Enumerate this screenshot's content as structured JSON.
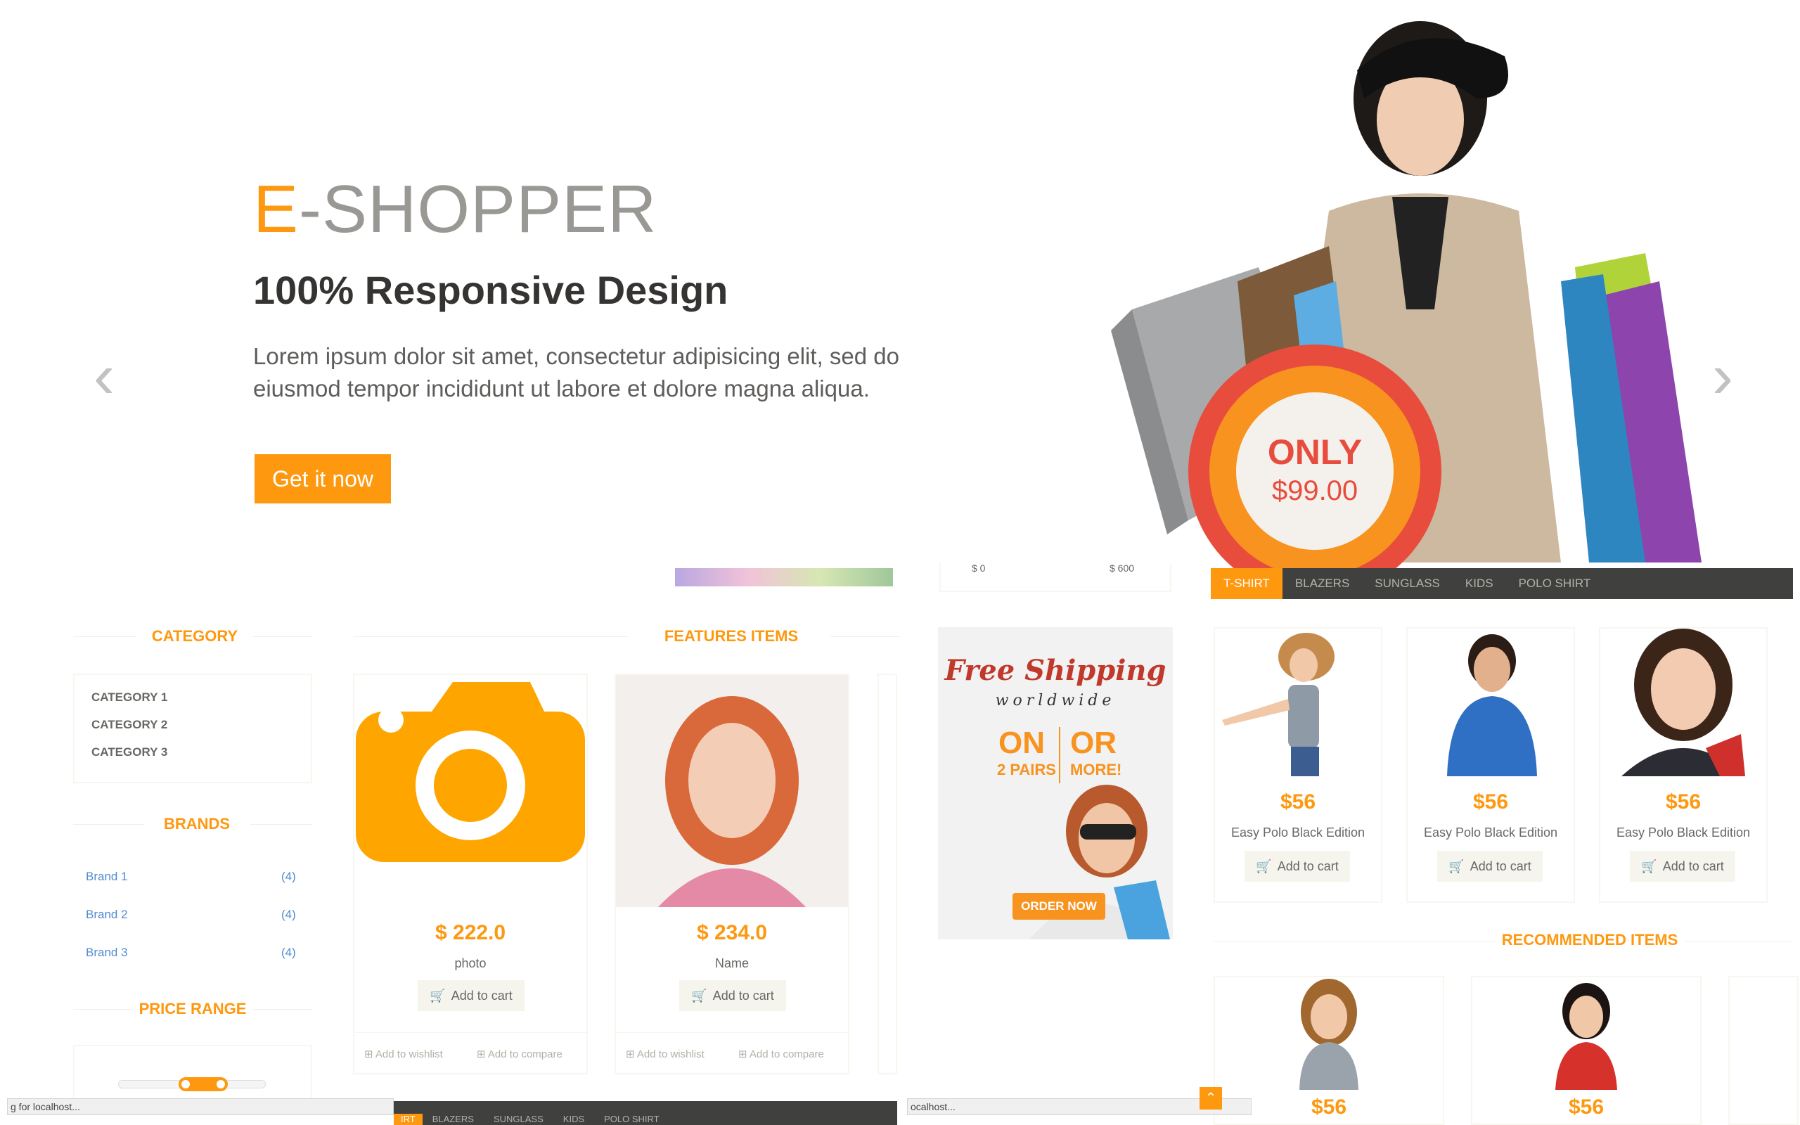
{
  "hero": {
    "brand_accent": "E",
    "brand_rest": "-SHOPPER",
    "subtitle": "100% Responsive Design",
    "text": "Lorem ipsum dolor sit amet, consectetur adipisicing elit, sed do eiusmod tempor incididunt ut labore et dolore magna aliqua.",
    "button": "Get it now",
    "badge_only": "ONLY",
    "badge_price": "$99.00",
    "prev_icon": "‹",
    "next_icon": "›"
  },
  "sidebar": {
    "category_title": "CATEGORY",
    "categories": [
      "CATEGORY 1",
      "CATEGORY 2",
      "CATEGORY 3"
    ],
    "brands_title": "BRANDS",
    "brands": [
      {
        "name": "Brand 1",
        "count": "(4)"
      },
      {
        "name": "Brand 2",
        "count": "(4)"
      },
      {
        "name": "Brand 3",
        "count": "(4)"
      }
    ],
    "price_range_title": "PRICE RANGE"
  },
  "features": {
    "title": "FEATURES ITEMS",
    "items": [
      {
        "price": "$ 222.0",
        "name": "photo",
        "cart": "Add to cart",
        "wishlist": "Add to wishlist",
        "compare": "Add to compare"
      },
      {
        "price": "$ 234.0",
        "name": "Name",
        "cart": "Add to cart",
        "wishlist": "Add to wishlist",
        "compare": "Add to compare"
      }
    ]
  },
  "price_slider": {
    "min_label": "$ 0",
    "max_label": "$ 600"
  },
  "ad": {
    "free": "Free Shipping",
    "world": "worldwide",
    "on": "ON",
    "or": "OR",
    "pairs": "2 PAIRS",
    "more": "MORE!",
    "order": "ORDER NOW"
  },
  "tabs": [
    "T-SHIRT",
    "BLAZERS",
    "SUNGLASS",
    "KIDS",
    "POLO SHIRT"
  ],
  "tab_products": [
    {
      "price": "$56",
      "name": "Easy Polo Black Edition",
      "cart": "Add to cart"
    },
    {
      "price": "$56",
      "name": "Easy Polo Black Edition",
      "cart": "Add to cart"
    },
    {
      "price": "$56",
      "name": "Easy Polo Black Edition",
      "cart": "Add to cart"
    }
  ],
  "recommended": {
    "title": "RECOMMENDED ITEMS",
    "prices": [
      "$56",
      "$56"
    ]
  },
  "status": {
    "left": "g for localhost...",
    "mid": "ocalhost...",
    "bottom_tabs": [
      "IRT",
      "BLAZERS",
      "SUNGLASS",
      "KIDS",
      "POLO SHIRT"
    ]
  },
  "colors": {
    "accent": "#fe980f",
    "tab_bar": "#40403e",
    "link": "#4e8cd0"
  }
}
